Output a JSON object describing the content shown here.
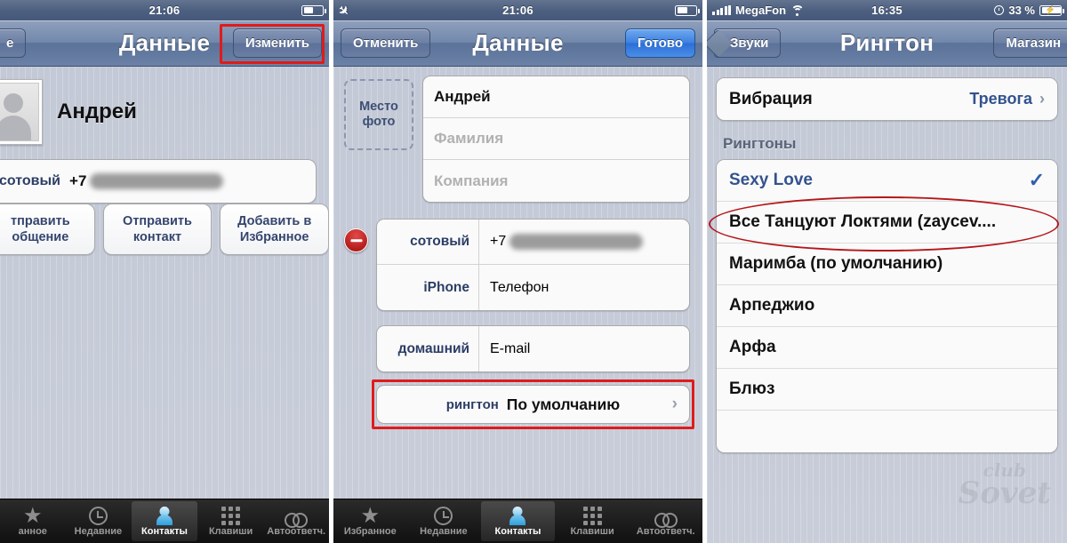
{
  "panel1": {
    "status": {
      "time": "21:06",
      "battery_icon": "battery-icon"
    },
    "nav": {
      "back_label": "е",
      "title": "Данные",
      "edit_label": "Изменить"
    },
    "contact": {
      "name": "Андрей",
      "avatar_icon": "person-placeholder-icon"
    },
    "phone": {
      "label": "сотовый",
      "prefix": "+7",
      "redacted": true
    },
    "actions": [
      {
        "line1": "тправить",
        "line2": "общение",
        "name": "send-message-button"
      },
      {
        "line1": "Отправить",
        "line2": "контакт",
        "name": "send-contact-button"
      },
      {
        "line1": "Добавить в",
        "line2": "Избранное",
        "name": "add-favorite-button"
      }
    ],
    "tabs": [
      {
        "label": "анное",
        "icon": "star-icon",
        "active": false
      },
      {
        "label": "Недавние",
        "icon": "clock-icon",
        "active": false
      },
      {
        "label": "Контакты",
        "icon": "person-icon",
        "active": true
      },
      {
        "label": "Клавиши",
        "icon": "keypad-icon",
        "active": false
      },
      {
        "label": "Автоответч.",
        "icon": "voicemail-icon",
        "active": false
      }
    ]
  },
  "panel2": {
    "status": {
      "airplane_icon": "airplane-icon",
      "time": "21:06",
      "battery_icon": "battery-icon"
    },
    "nav": {
      "cancel_label": "Отменить",
      "title": "Данные",
      "done_label": "Готово"
    },
    "photo_box": {
      "line1": "Место",
      "line2": "фото"
    },
    "name_fields": [
      {
        "value": "Андрей",
        "placeholder": "",
        "name": "first-name-field"
      },
      {
        "value": "",
        "placeholder": "Фамилия",
        "name": "last-name-field"
      },
      {
        "value": "",
        "placeholder": "Компания",
        "name": "company-field"
      }
    ],
    "phone_fields": [
      {
        "label": "сотовый",
        "value": "+7",
        "placeholder": "",
        "redacted": true,
        "name": "mobile-phone-field"
      },
      {
        "label": "iPhone",
        "value": "",
        "placeholder": "Телефон",
        "redacted": false,
        "name": "iphone-phone-field"
      }
    ],
    "email_field": {
      "label": "домашний",
      "placeholder": "E-mail",
      "name": "home-email-field"
    },
    "ringtone": {
      "label": "рингтон",
      "value": "По умолчанию",
      "chevron": "chevron-right-icon"
    },
    "tabs": [
      {
        "label": "Избранное",
        "icon": "star-icon",
        "active": false
      },
      {
        "label": "Недавние",
        "icon": "clock-icon",
        "active": false
      },
      {
        "label": "Контакты",
        "icon": "person-icon",
        "active": true
      },
      {
        "label": "Клавиши",
        "icon": "keypad-icon",
        "active": false
      },
      {
        "label": "Автоответч.",
        "icon": "voicemail-icon",
        "active": false
      }
    ]
  },
  "panel3": {
    "status": {
      "carrier": "MegaFon",
      "signal_icon": "signal-bars-icon",
      "wifi_icon": "wifi-icon",
      "time": "16:35",
      "alarm_icon": "alarm-clock-icon",
      "battery_percent": "33 %",
      "battery_icon": "battery-charging-icon"
    },
    "nav": {
      "back_label": "Звуки",
      "title": "Рингтон",
      "store_label": "Магазин"
    },
    "vibration": {
      "label": "Вибрация",
      "value": "Тревога",
      "chevron": "chevron-right-icon"
    },
    "section_header": "Рингтоны",
    "ringtones": [
      {
        "label": "Sexy Love",
        "selected": true,
        "highlighted": true
      },
      {
        "label": "Все Танцуют Локтями (zaycev....",
        "selected": false,
        "highlighted": false
      },
      {
        "label": "Маримба (по умолчанию)",
        "selected": false,
        "highlighted": false
      },
      {
        "label": "Арпеджио",
        "selected": false,
        "highlighted": false
      },
      {
        "label": "Арфа",
        "selected": false,
        "highlighted": false
      },
      {
        "label": "Блюз",
        "selected": false,
        "highlighted": false
      }
    ],
    "watermark": {
      "line1": "club",
      "line2": "Sovet"
    }
  }
}
